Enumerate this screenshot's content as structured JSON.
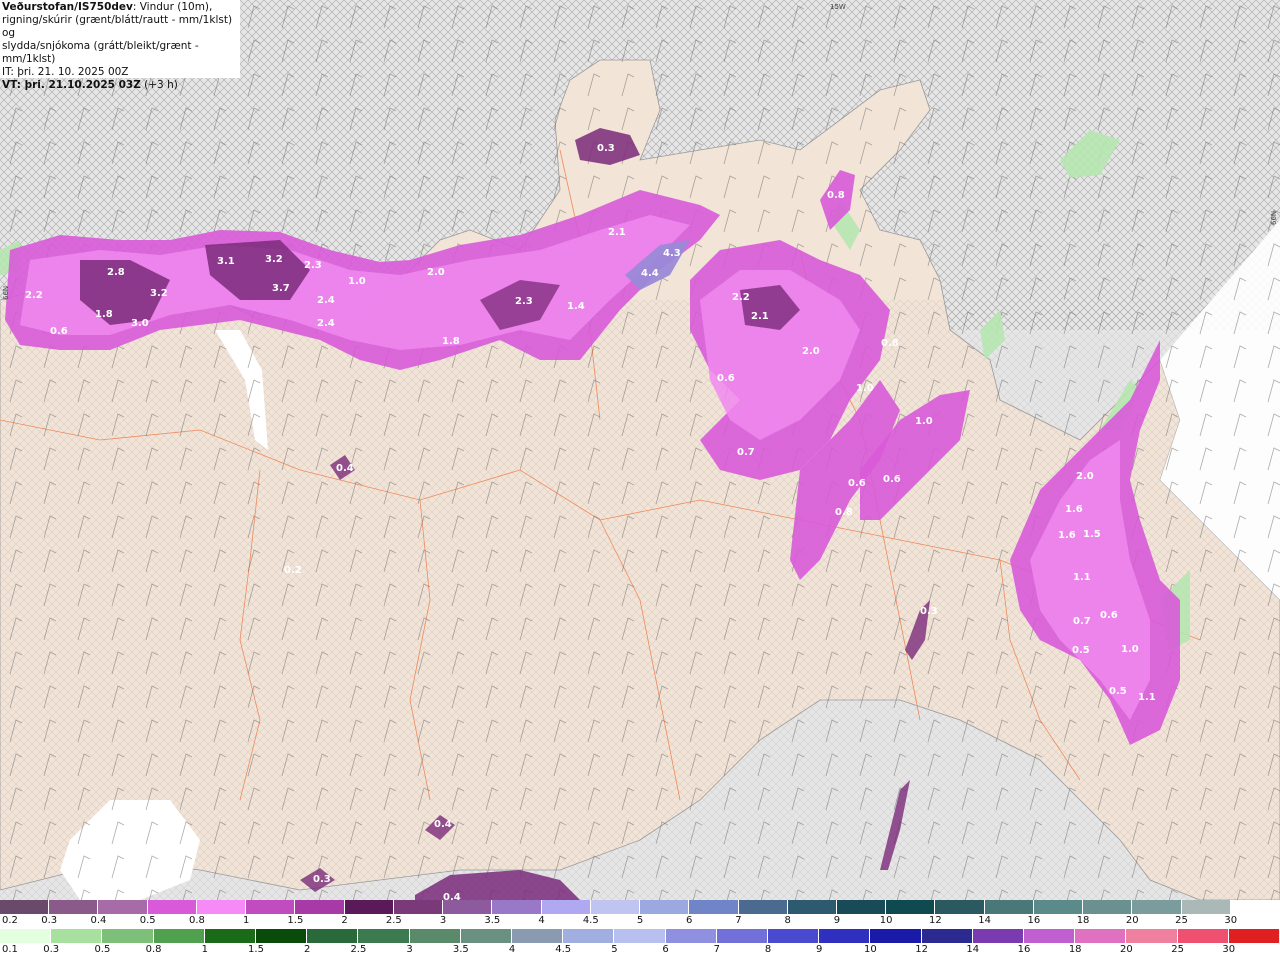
{
  "header": {
    "source": "Veðurstofan/IS750dev",
    "desc_1": ": Vindur (10m),",
    "desc_2": "rigning/skúrir (grænt/blátt/rautt - mm/1klst) og",
    "desc_3": "slydda/snjókoma (grátt/bleikt/grænt - mm/1klst)",
    "init_time": "IT: þri. 21. 10. 2025 00Z",
    "valid_label": "VT: þri. 21.10.2025 03Z",
    "valid_offset": " (+3 h)"
  },
  "map": {
    "edge_labels": [
      "15W",
      "66N",
      "66N"
    ],
    "precip_values": [
      "0.3",
      "2.8",
      "2.2",
      "3.2",
      "0.6",
      "1.8",
      "3.0",
      "3.1",
      "3.2",
      "3.7",
      "2.3",
      "2.4",
      "2.4",
      "1.0",
      "2.0",
      "1.8",
      "2.3",
      "1.4",
      "2.1",
      "4.3",
      "4.4",
      "2.2",
      "2.1",
      "2.0",
      "0.6",
      "0.8",
      "0.8",
      "1.0",
      "1.0",
      "0.7",
      "0.6",
      "0.8",
      "0.6",
      "0.4",
      "0.2",
      "2.0",
      "1.6",
      "1.6",
      "1.5",
      "1.1",
      "0.6",
      "0.7",
      "0.5",
      "1.0",
      "0.5",
      "1.1",
      "0.4",
      "0.3",
      "0.3",
      "0.4"
    ],
    "colors": {
      "sea": "#e6e6e6",
      "land": "#f2e4d7",
      "roads": "#f08a5a",
      "snow_mid": "#d85ad8",
      "snow_light": "#f08af0",
      "snow_dark": "#7a2a7a",
      "snow_max": "#9a8ad8",
      "rain_light": "#b6e6b0"
    }
  },
  "legend_snow": {
    "labels": [
      "0.2",
      "0.3",
      "0.4",
      "0.5",
      "0.8",
      "1",
      "1.5",
      "2",
      "2.5",
      "3",
      "3.5",
      "4",
      "4.5",
      "5",
      "6",
      "7",
      "8",
      "9",
      "10",
      "12",
      "14",
      "16",
      "18",
      "20",
      "25",
      "30"
    ],
    "colors": [
      "#6a4a6a",
      "#8a5a8a",
      "#a76ca7",
      "#d85ad8",
      "#f68af6",
      "#c04cc0",
      "#a83aa8",
      "#5a1a5a",
      "#7a3a7a",
      "#8e5a9e",
      "#9a78c8",
      "#b0a8f0",
      "#c0c4f0",
      "#9ca8e0",
      "#7084c8",
      "#4a6a90",
      "#2e5a70",
      "#184a58",
      "#0e4a50",
      "#2a5a60",
      "#4a7878",
      "#5a8a8a",
      "#6a9090",
      "#7a9c9c",
      "#aab8b8",
      "#ffffff"
    ]
  },
  "legend_rain": {
    "labels": [
      "0.1",
      "0.3",
      "0.5",
      "0.8",
      "1",
      "1.5",
      "2",
      "2.5",
      "3",
      "3.5",
      "4",
      "4.5",
      "5",
      "6",
      "7",
      "8",
      "9",
      "10",
      "12",
      "14",
      "16",
      "18",
      "20",
      "25",
      "30"
    ],
    "colors": [
      "#e4ffe0",
      "#a8e0a0",
      "#7ec07a",
      "#50a050",
      "#1a6a1a",
      "#0a4a0a",
      "#2a6a3a",
      "#3e7a50",
      "#5a8a6a",
      "#6a9080",
      "#8a9ab0",
      "#a0aee0",
      "#b8c0f0",
      "#9090e0",
      "#7070d8",
      "#4a4ad0",
      "#3030c0",
      "#1a1aa8",
      "#2a2a90",
      "#7a3ab0",
      "#c060d0",
      "#e070c0",
      "#f080a0",
      "#f05070",
      "#e02020"
    ]
  }
}
